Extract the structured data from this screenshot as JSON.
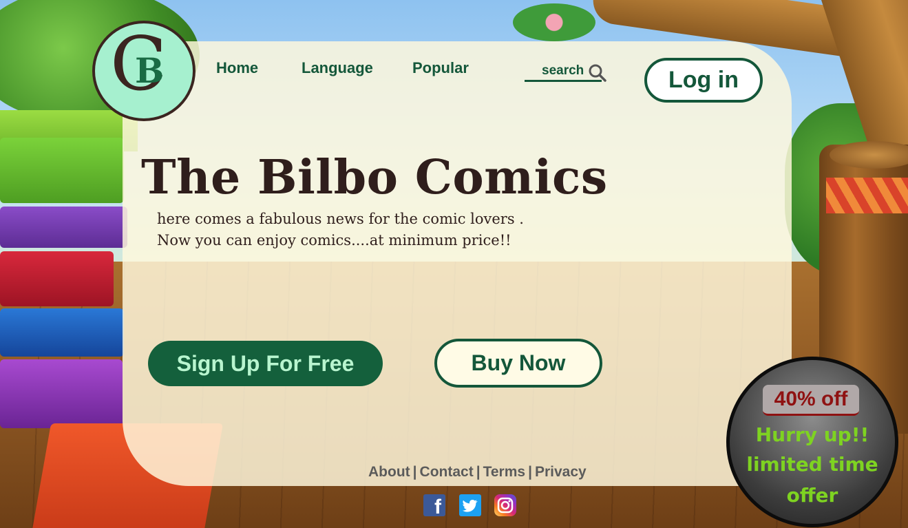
{
  "brand": {
    "logo_letters": [
      "C",
      "B"
    ]
  },
  "nav": {
    "home": "Home",
    "language": "Language",
    "popular": "Popular"
  },
  "search": {
    "label": "search"
  },
  "auth": {
    "login": "Log in"
  },
  "hero": {
    "title": "The Bilbo Comics",
    "line1": "here comes a fabulous news for the comic lovers .",
    "line2": "Now you can enjoy comics....at minimum price!!"
  },
  "cta": {
    "signup": "Sign Up For Free",
    "buy": "Buy Now"
  },
  "footer": {
    "about": "About",
    "contact": "Contact",
    "terms": "Terms",
    "privacy": "Privacy",
    "separator": "|"
  },
  "social": {
    "facebook_glyph": "f"
  },
  "offer": {
    "discount": "40% off",
    "line1": "Hurry up!!",
    "line2": "limited time",
    "line3": "offer"
  },
  "colors": {
    "primary": "#14573A",
    "panel": "#FFF8DC",
    "title": "#2F1E1C",
    "offer_text": "#7ED321",
    "offer_discount": "#8F1212"
  },
  "icons": [
    "search-icon",
    "facebook-icon",
    "twitter-icon",
    "instagram-icon"
  ]
}
